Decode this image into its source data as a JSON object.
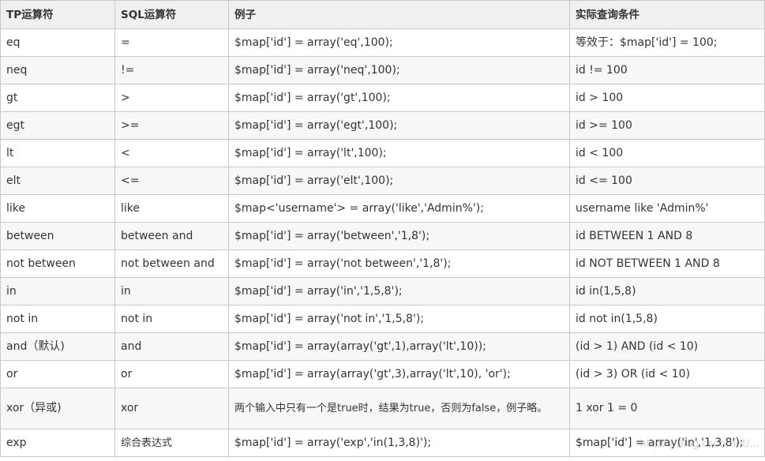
{
  "table": {
    "headers": [
      "TP运算符",
      "SQL运算符",
      "例子",
      "实际查询条件"
    ],
    "rows": [
      [
        "eq",
        "=",
        "$map['id'] = array('eq',100);",
        "等效于：$map['id'] = 100;"
      ],
      [
        "neq",
        "!=",
        "$map['id'] = array('neq',100);",
        "id != 100"
      ],
      [
        "gt",
        ">",
        "$map['id'] = array('gt',100);",
        "id > 100"
      ],
      [
        "egt",
        ">=",
        "$map['id'] = array('egt',100);",
        "id >= 100"
      ],
      [
        "lt",
        "<",
        "$map['id'] = array('lt',100);",
        "id < 100"
      ],
      [
        "elt",
        "<=",
        "$map['id'] = array('elt',100);",
        "id <= 100"
      ],
      [
        "like",
        "like",
        "$map<'username'> = array('like','Admin%');",
        "username like 'Admin%'"
      ],
      [
        "between",
        "between and",
        "$map['id'] = array('between','1,8');",
        "id BETWEEN 1 AND 8"
      ],
      [
        "not between",
        "not between and",
        "$map['id'] = array('not between','1,8');",
        "id NOT BETWEEN 1 AND 8"
      ],
      [
        "in",
        "in",
        "$map['id'] = array('in','1,5,8');",
        "id in(1,5,8)"
      ],
      [
        "not in",
        "not in",
        "$map['id'] = array('not in','1,5,8');",
        "id not in(1,5,8)"
      ],
      [
        "and（默认)",
        "and",
        "$map['id'] = array(array('gt',1),array('lt',10));",
        "(id > 1) AND (id < 10)"
      ],
      [
        "or",
        "or",
        "$map['id'] = array(array('gt',3),array('lt',10), 'or');",
        "(id > 3) OR (id < 10)"
      ],
      [
        "xor（异或)",
        "xor",
        "两个输入中只有一个是true时，结果为true，否则为false，例子略。",
        "1 xor 1 = 0"
      ],
      [
        "exp",
        "综合表达式",
        "$map['id'] = array('exp','in(1,3,8)');",
        "$map['id'] = array('in','1,3,8');"
      ]
    ],
    "watermark": "https://blog.csdn.net/..."
  }
}
